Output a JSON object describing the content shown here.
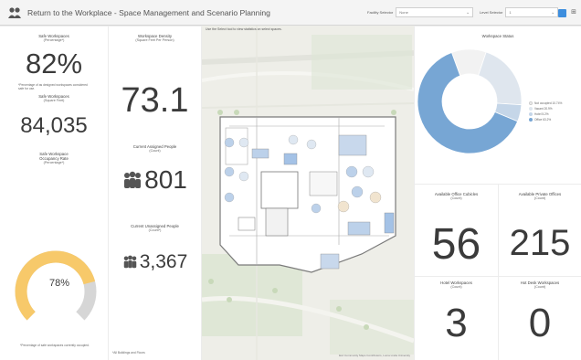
{
  "header": {
    "title": "Return to the Workplace - Space Management and Scenario Planning",
    "facility_label": "Facility Selector",
    "facility_value": "None",
    "level_label": "Level Selector",
    "level_value": "1"
  },
  "left": {
    "safe_pct_title": "Safe Workspaces",
    "safe_pct_unit": "(Percentage*)",
    "safe_pct_value": "82%",
    "safe_pct_note": "*Percentage of as designed workspaces considered safe for use.",
    "safe_sqft_title": "Safe Workspaces",
    "safe_sqft_unit": "(Square Feet)",
    "safe_sqft_value": "84,035",
    "occupancy_title": "Safe Workspace",
    "occupancy_title2": "Occupancy Rate",
    "occupancy_unit": "(Percentage*)",
    "occupancy_value": "78%",
    "occupancy_fraction": 0.78,
    "occupancy_note": "*Percentage of safe workspaces currently occupied."
  },
  "density": {
    "title": "Workspace Density",
    "unit": "(Square Feet Per Person)",
    "value": "73.1",
    "assigned_title": "Current Assigned People",
    "assigned_unit": "(Count)",
    "assigned_value": "801",
    "unassigned_title": "Current Unassigned People",
    "unassigned_unit": "(Count*)",
    "unassigned_value": "3,367",
    "footer": "*All Buildings and Floors"
  },
  "map": {
    "hint": "Use the Select tool to view statistics on select spaces.",
    "attribution": "Esri Community Maps Contributors, Loma Linda University"
  },
  "status": {
    "title": "Workspace Status",
    "legend": [
      "Not occupied 10.74%",
      "Vacant 20.9%",
      "Hotel 5.2%",
      "Office 63.2%"
    ],
    "colors": [
      "#f2f2f2",
      "#dfe6ee",
      "#c5d6e8",
      "#77a6d4"
    ],
    "values": [
      10.74,
      20.9,
      5.2,
      63.2
    ]
  },
  "counts": {
    "cubicles_title": "Available Office Cubicles",
    "cubicles_unit": "(Count)",
    "cubicles_value": "56",
    "private_title": "Available Private Offices",
    "private_unit": "(Count)",
    "private_value": "215",
    "hotel_title": "Hotel Workspaces",
    "hotel_unit": "(Count)",
    "hotel_value": "3",
    "hotdesk_title": "Hot Desk Workspaces",
    "hotdesk_unit": "(Count)",
    "hotdesk_value": "0"
  }
}
